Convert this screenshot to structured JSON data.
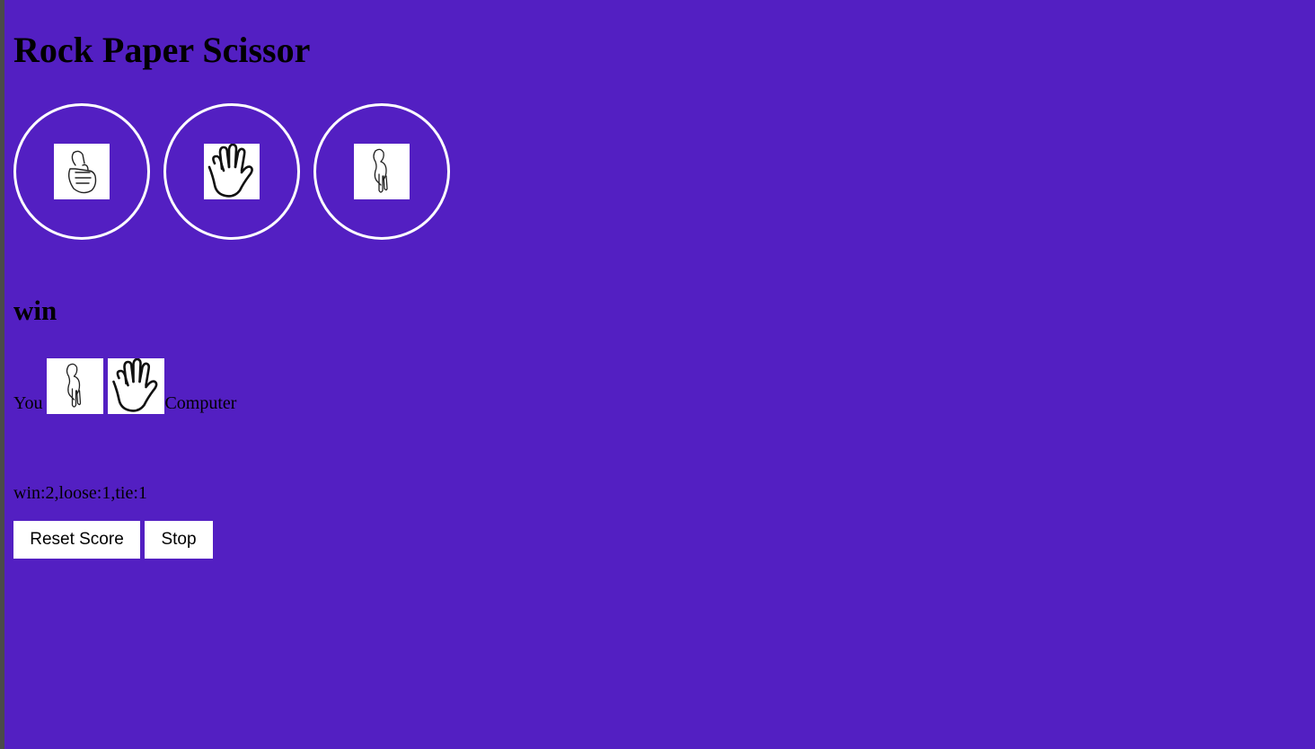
{
  "game": {
    "title": "Rock Paper Scissor",
    "choices": [
      {
        "id": "rock",
        "icon": "rock-hand-icon"
      },
      {
        "id": "paper",
        "icon": "paper-hand-icon"
      },
      {
        "id": "scissor",
        "icon": "scissor-hand-icon"
      }
    ],
    "result": "win",
    "you_label": "You",
    "computer_label": "Computer",
    "you_pick_icon": "scissor-hand-icon",
    "computer_pick_icon": "paper-hand-icon",
    "score_text": "win:2,loose:1,tie:1",
    "buttons": {
      "reset_label": "Reset Score",
      "stop_label": "Stop"
    }
  },
  "colors": {
    "background": "#531fc2",
    "circle_border": "#ffffff"
  }
}
